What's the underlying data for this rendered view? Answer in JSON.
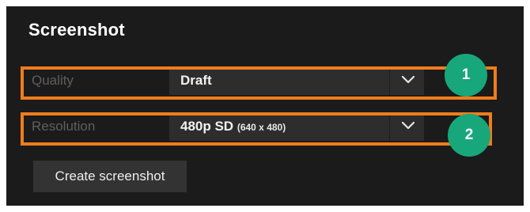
{
  "panel": {
    "title": "Screenshot"
  },
  "settings": [
    {
      "label": "Quality",
      "value": "Draft",
      "value_sub": ""
    },
    {
      "label": "Resolution",
      "value": "480p SD",
      "value_sub": "(640 x 480)"
    }
  ],
  "callouts": {
    "badge_1": "1",
    "badge_2": "2"
  },
  "actions": {
    "create_screenshot": "Create screenshot"
  },
  "colors": {
    "panel_bg": "#1b1b1b",
    "field_bg": "#2d2d2d",
    "highlight": "#f07d1c",
    "badge": "#17a77b"
  },
  "icons": {
    "dropdown": "chevron-down-icon"
  }
}
